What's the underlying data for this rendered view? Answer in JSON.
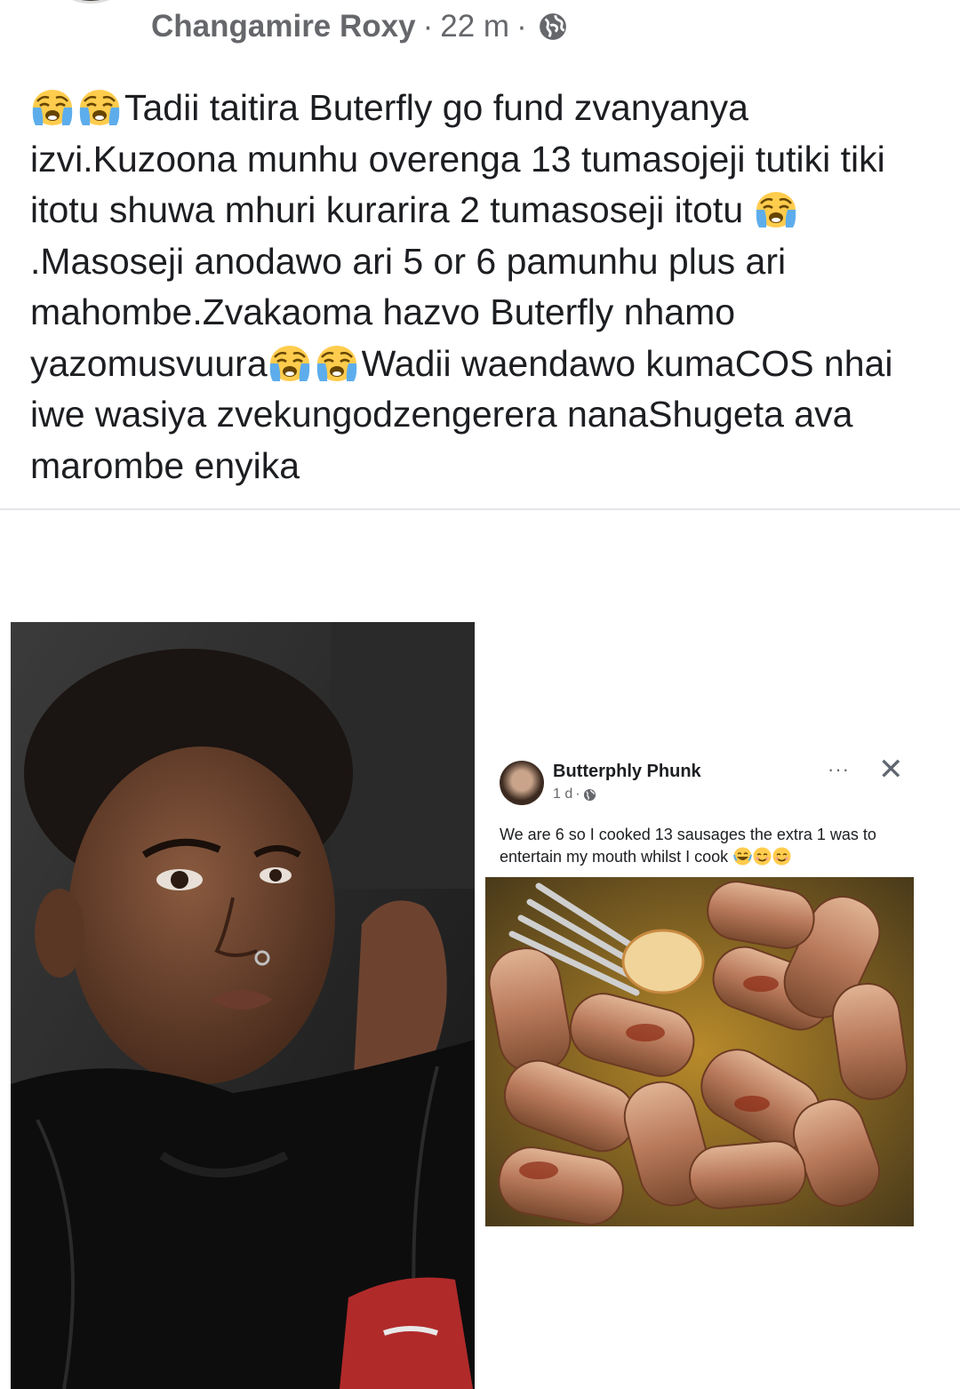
{
  "header": {
    "author": "Changamire Roxy",
    "separator": "·",
    "time": "22 m",
    "privacy_icon": "globe-icon"
  },
  "post": {
    "emoji_icon": "loudly-crying-face",
    "segments": [
      "Tadii taitira Buterfly go fund zvanyanya izvi.Kuzoona munhu overenga 13 tumasojeji tutiki tiki itotu shuwa mhuri kurarira 2 tumasoseji itotu ",
      ".Masoseji anodawo ari 5 or 6 pamunhu plus ari mahombe.Zvakaoma hazvo Buterfly nhamo yazomusvuura",
      "Wadii waendawo kumaCOS nhai iwe wasiya zvekungodzengerera nanaShugeta ava marombe enyika"
    ]
  },
  "shared_screenshot": {
    "name": "Butterphly Phunk",
    "time": "1 d",
    "separator": "·",
    "more": "···",
    "close": "✕",
    "text": "We are 6 so I cooked 13 sausages the extra 1 was to entertain my mouth whilst I cook"
  },
  "colors": {
    "text": "#1c1e21",
    "meta": "#65676b",
    "divider": "#e4e6eb"
  }
}
